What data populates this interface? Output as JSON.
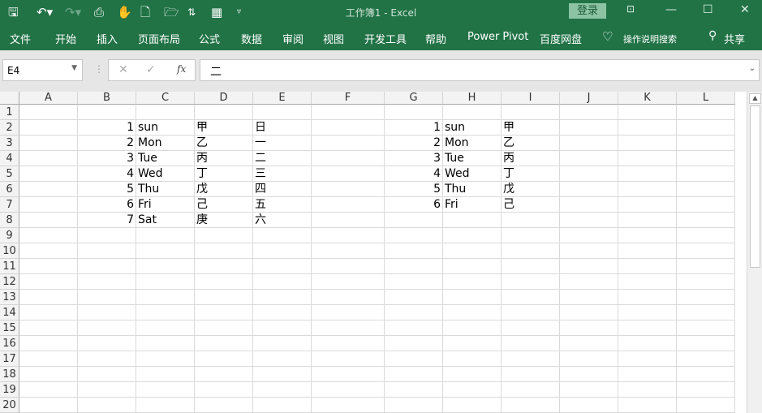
{
  "titlebar": {
    "title": "工作簿1  -  Excel",
    "login": "登录",
    "quick_access": [
      "save-icon",
      "undo-icon",
      "redo-icon",
      "print-preview-icon",
      "touch-mode-icon",
      "new-file-icon",
      "open-folder-icon",
      "sort-icon",
      "table-icon",
      "customize-icon"
    ]
  },
  "ribbon": {
    "tabs": [
      "文件",
      "开始",
      "插入",
      "页面布局",
      "公式",
      "数据",
      "审阅",
      "视图",
      "开发工具",
      "帮助",
      "Power Pivot",
      "百度网盘"
    ],
    "tell_me": "操作说明搜索",
    "share": "共享"
  },
  "formula_bar": {
    "name_box": "E4",
    "formula": "二",
    "fx": "fx"
  },
  "sheet": {
    "columns": [
      "A",
      "B",
      "C",
      "D",
      "E",
      "F",
      "G",
      "H",
      "I",
      "J",
      "K",
      "L"
    ],
    "rows": 20,
    "cells": [
      {
        "ref": "B2",
        "v": "1",
        "num": true
      },
      {
        "ref": "C2",
        "v": "sun"
      },
      {
        "ref": "D2",
        "v": "甲"
      },
      {
        "ref": "E2",
        "v": "日"
      },
      {
        "ref": "B3",
        "v": "2",
        "num": true
      },
      {
        "ref": "C3",
        "v": "Mon"
      },
      {
        "ref": "D3",
        "v": "乙"
      },
      {
        "ref": "E3",
        "v": "一"
      },
      {
        "ref": "B4",
        "v": "3",
        "num": true
      },
      {
        "ref": "C4",
        "v": "Tue"
      },
      {
        "ref": "D4",
        "v": "丙"
      },
      {
        "ref": "E4",
        "v": "二"
      },
      {
        "ref": "B5",
        "v": "4",
        "num": true
      },
      {
        "ref": "C5",
        "v": "Wed"
      },
      {
        "ref": "D5",
        "v": "丁"
      },
      {
        "ref": "E5",
        "v": "三"
      },
      {
        "ref": "B6",
        "v": "5",
        "num": true
      },
      {
        "ref": "C6",
        "v": "Thu"
      },
      {
        "ref": "D6",
        "v": "戊"
      },
      {
        "ref": "E6",
        "v": "四"
      },
      {
        "ref": "B7",
        "v": "6",
        "num": true
      },
      {
        "ref": "C7",
        "v": "Fri"
      },
      {
        "ref": "D7",
        "v": "己"
      },
      {
        "ref": "E7",
        "v": "五"
      },
      {
        "ref": "B8",
        "v": "7",
        "num": true
      },
      {
        "ref": "C8",
        "v": "Sat"
      },
      {
        "ref": "D8",
        "v": "庚"
      },
      {
        "ref": "E8",
        "v": "六"
      },
      {
        "ref": "G2",
        "v": "1",
        "num": true
      },
      {
        "ref": "H2",
        "v": "sun"
      },
      {
        "ref": "I2",
        "v": "甲"
      },
      {
        "ref": "G3",
        "v": "2",
        "num": true
      },
      {
        "ref": "H3",
        "v": "Mon"
      },
      {
        "ref": "I3",
        "v": "乙"
      },
      {
        "ref": "G4",
        "v": "3",
        "num": true
      },
      {
        "ref": "H4",
        "v": "Tue"
      },
      {
        "ref": "I4",
        "v": "丙"
      },
      {
        "ref": "G5",
        "v": "4",
        "num": true
      },
      {
        "ref": "H5",
        "v": "Wed"
      },
      {
        "ref": "I5",
        "v": "丁"
      },
      {
        "ref": "G6",
        "v": "5",
        "num": true
      },
      {
        "ref": "H6",
        "v": "Thu"
      },
      {
        "ref": "I6",
        "v": "戊"
      },
      {
        "ref": "G7",
        "v": "6",
        "num": true
      },
      {
        "ref": "H7",
        "v": "Fri"
      },
      {
        "ref": "I7",
        "v": "己"
      }
    ]
  }
}
